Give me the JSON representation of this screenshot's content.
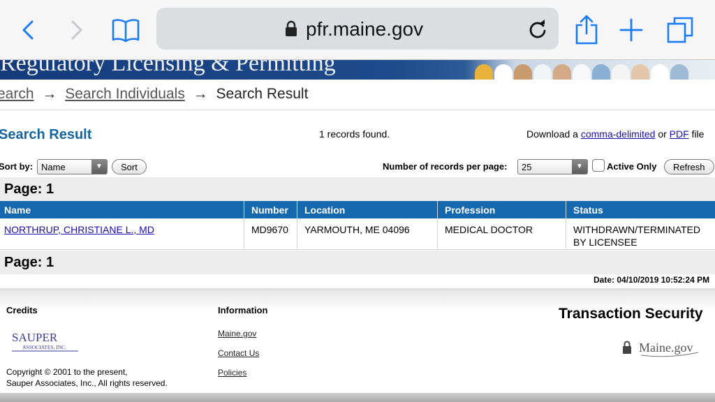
{
  "browser": {
    "url": "pfr.maine.gov",
    "icons": [
      "back-icon",
      "forward-icon",
      "bookmarks-icon",
      "lock-icon",
      "reload-icon",
      "share-icon",
      "new-tab-icon",
      "tabs-icon"
    ],
    "accent_color": "#1a7bf2"
  },
  "banner": {
    "title": "Regulatory Licensing & Permitting"
  },
  "breadcrumb": {
    "items": [
      "earch",
      "Search Individuals",
      "Search Result"
    ],
    "separator": "→"
  },
  "result": {
    "title": "Search Result",
    "records_found": "1 records found.",
    "download_prefix": "Download a",
    "download_csv": "comma-delimited",
    "download_or": "or",
    "download_pdf": "PDF",
    "download_suffix": "file"
  },
  "controls": {
    "sort_label": "Sort by:",
    "sort_value": "Name",
    "sort_button": "Sort",
    "per_page_label": "Number of records per page:",
    "per_page_value": "25",
    "active_only_label": "Active Only",
    "refresh_button": "Refresh"
  },
  "pagination": {
    "top": "Page: 1",
    "bottom": "Page: 1"
  },
  "table": {
    "headers": [
      "Name",
      "Number",
      "Location",
      "Profession",
      "Status"
    ],
    "rows": [
      {
        "name": "NORTHRUP, CHRISTIANE L., MD",
        "number": "MD9670",
        "location": "YARMOUTH, ME 04096",
        "profession": "MEDICAL DOCTOR",
        "status_line1": "WITHDRAWN/TERMINATED",
        "status_line2": "BY LICENSEE"
      }
    ],
    "header_color": "#1567ae"
  },
  "date_line": "Date: 04/10/2019 10:52:24 PM",
  "footer": {
    "credits_heading": "Credits",
    "sauper_logo_text": "SAUPER",
    "sauper_logo_sub": "ASSOCIATES, INC.",
    "copyright_line1": "Copyright © 2001 to the present,",
    "copyright_line2": "Sauper Associates, Inc., All rights reserved.",
    "information_heading": "Information",
    "links": [
      "Maine.gov",
      "Contact Us",
      "Policies"
    ],
    "security_heading": "Transaction Security",
    "maine_logo_text": "Maine.gov"
  }
}
